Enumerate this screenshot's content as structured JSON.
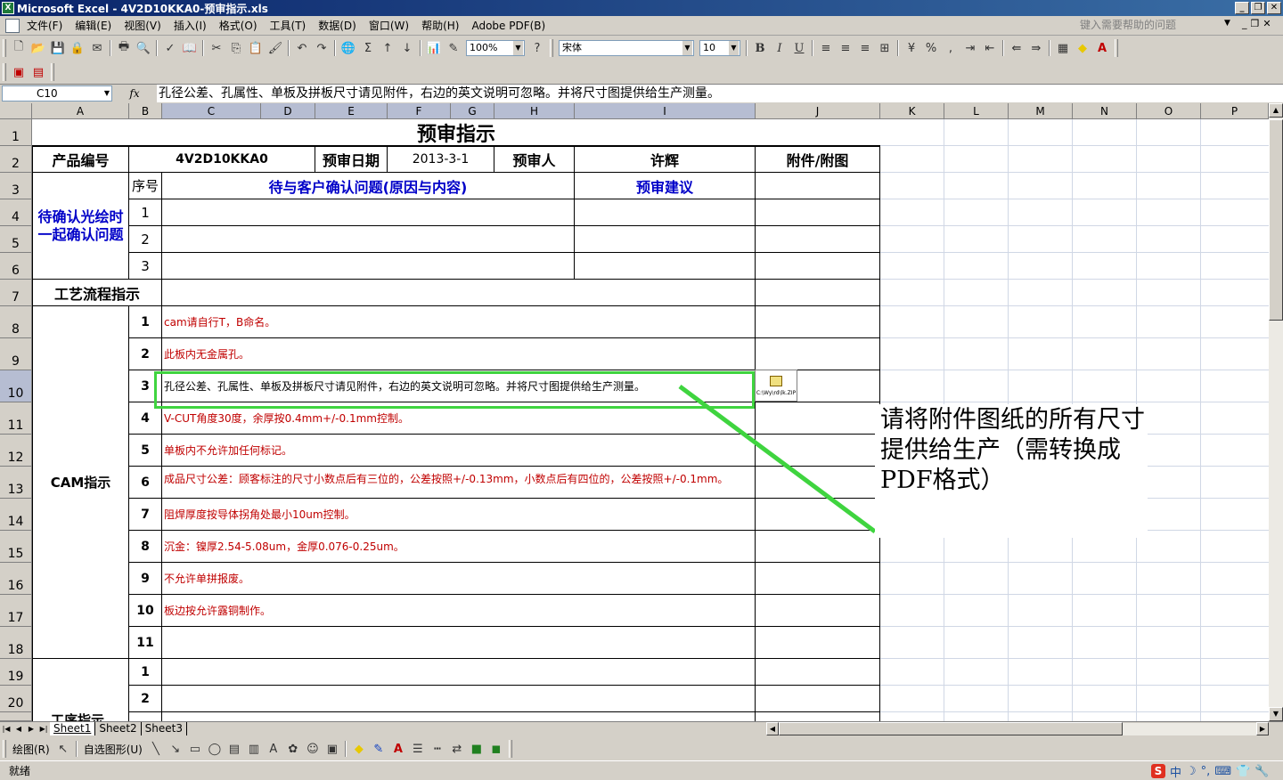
{
  "window": {
    "app_icon": "X",
    "title": "Microsoft Excel - 4V2D10KKA0-预审指示.xls",
    "buttons": [
      "_",
      "❐",
      "✕"
    ]
  },
  "menu": {
    "items": [
      "文件(F)",
      "编辑(E)",
      "视图(V)",
      "插入(I)",
      "格式(O)",
      "工具(T)",
      "数据(D)",
      "窗口(W)",
      "帮助(H)",
      "Adobe PDF(B)"
    ],
    "help_placeholder": "键入需要帮助的问题",
    "mdi_buttons": [
      "_",
      "❐",
      "✕"
    ]
  },
  "toolbar": {
    "zoom": "100%",
    "font": "宋体",
    "font_size": "10",
    "bold": "B",
    "italic": "I",
    "underline": "U",
    "percent": "%",
    "comma": ","
  },
  "formula_bar": {
    "name_box": "C10",
    "fx": "fx",
    "content": "孔径公差、孔属性、单板及拼板尺寸请见附件，右边的英文说明可忽略。并将尺寸图提供给生产测量。"
  },
  "columns": [
    "A",
    "B",
    "C",
    "D",
    "E",
    "F",
    "G",
    "H",
    "I",
    "J",
    "K",
    "L",
    "M",
    "N",
    "O",
    "P"
  ],
  "rows": [
    "1",
    "2",
    "3",
    "4",
    "5",
    "6",
    "7",
    "8",
    "9",
    "10",
    "11",
    "12",
    "13",
    "14",
    "15",
    "16",
    "17",
    "18",
    "19",
    "20"
  ],
  "sheet": {
    "title": "预审指示",
    "product_no_label": "产品编号",
    "product_no": "4V2D10KKA0",
    "review_date_label": "预审日期",
    "review_date": "2013-3-1",
    "reviewer_label": "预审人",
    "reviewer": "许辉",
    "attachment_label": "附件/附图",
    "seq_label": "序号",
    "issue_label": "待与客户确认问题(原因与内容)",
    "suggest_label": "预审建议",
    "confirm_group": "待确认光绘时一起确认问题",
    "confirm_rows": [
      "1",
      "2",
      "3"
    ],
    "process_label": "工艺流程指示",
    "cam_label": "CAM指示",
    "cam_nums": [
      "1",
      "2",
      "3",
      "4",
      "5",
      "6",
      "7",
      "8",
      "9",
      "10",
      "11"
    ],
    "cam_items": [
      "cam请自行T，B命名。",
      "此板内无金属孔。",
      "孔径公差、孔属性、单板及拼板尺寸请见附件，右边的英文说明可忽略。并将尺寸图提供给生产测量。",
      "V-CUT角度30度，余厚按0.4mm+/-0.1mm控制。",
      "单板内不允许加任何标记。",
      "成品尺寸公差：顾客标注的尺寸小数点后有三位的，公差按照+/-0.13mm，小数点后有四位的，公差按照+/-0.1mm。",
      "阻焊厚度按导体拐角处最小10um控制。",
      "沉金：镍厚2.54-5.08um，金厚0.076-0.25um。",
      "不允许单拼报废。",
      "板边按允许露铜制作。",
      ""
    ],
    "next_nums": [
      "1",
      "2"
    ],
    "next_group": "工序指示",
    "attachment_icon_label": "C:\\Wy\\rd\\lk.ZIP"
  },
  "callout": "请将附件图纸的所有尺寸提供给生产（需转换成PDF格式）",
  "tabs": [
    "Sheet1",
    "Sheet2",
    "Sheet3"
  ],
  "drawing_toolbar": {
    "draw": "绘图(R)",
    "autoshape": "自选图形(U)"
  },
  "status": {
    "text": "就绪",
    "ime": [
      "S",
      "中",
      "☽",
      "°,",
      "⌨",
      "👕",
      "🔧"
    ]
  },
  "colors": {
    "title_bar": "#0a246a",
    "selection": "#3fd43f",
    "red_text": "#c00000",
    "blue_text": "#0000c8",
    "header_selected": "#b6bdd2"
  }
}
